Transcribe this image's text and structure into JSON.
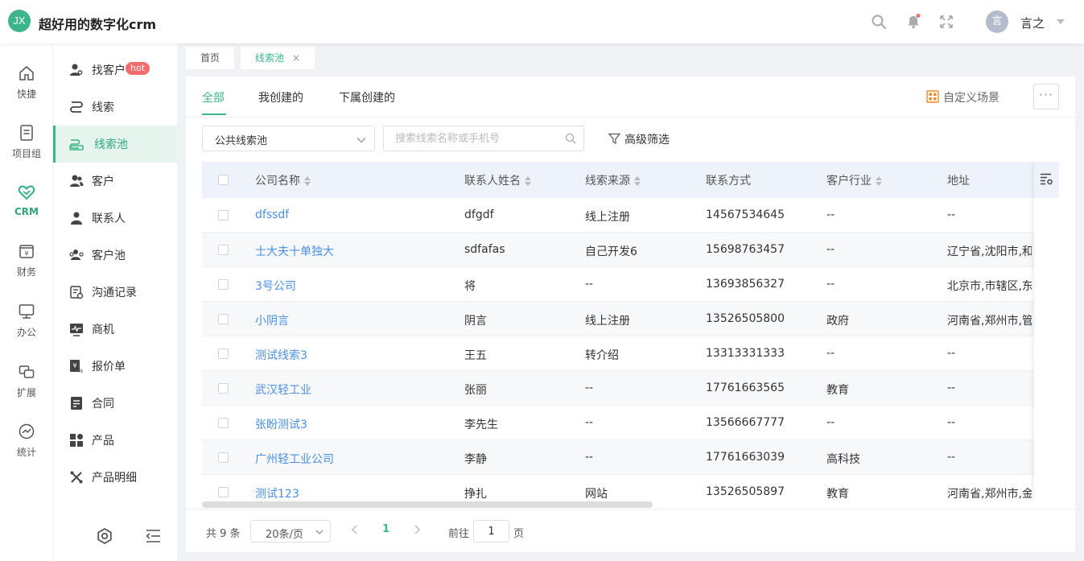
{
  "header": {
    "logo_text": "JX",
    "app_title": "超好用的数字化crm",
    "avatar_text": "言",
    "username": "言之",
    "notification_dot_color": "#f56c6c"
  },
  "rail": {
    "items": [
      {
        "label": "快捷",
        "icon": "home-icon"
      },
      {
        "label": "项目组",
        "icon": "document-icon"
      },
      {
        "label": "CRM",
        "icon": "handshake-heart-icon",
        "active": true
      },
      {
        "label": "财务",
        "icon": "finance-icon"
      },
      {
        "label": "办公",
        "icon": "monitor-icon"
      },
      {
        "label": "扩展",
        "icon": "extend-icon"
      },
      {
        "label": "统计",
        "icon": "stats-icon"
      }
    ]
  },
  "subnav": {
    "hot_badge": "hot",
    "items": [
      {
        "label": "找客户",
        "icon": "find-customer-icon"
      },
      {
        "label": "线索",
        "icon": "clue-icon"
      },
      {
        "label": "线索池",
        "icon": "clue-pool-icon",
        "active": true
      },
      {
        "label": "客户",
        "icon": "customer-icon"
      },
      {
        "label": "联系人",
        "icon": "contact-icon"
      },
      {
        "label": "客户池",
        "icon": "customer-pool-icon"
      },
      {
        "label": "沟通记录",
        "icon": "record-icon"
      },
      {
        "label": "商机",
        "icon": "opportunity-icon"
      },
      {
        "label": "报价单",
        "icon": "quote-icon"
      },
      {
        "label": "合同",
        "icon": "contract-icon"
      },
      {
        "label": "产品",
        "icon": "product-icon"
      },
      {
        "label": "产品明细",
        "icon": "product-detail-icon"
      }
    ]
  },
  "page_tabs": [
    {
      "label": "首页"
    },
    {
      "label": "线索池",
      "active": true,
      "close": "×"
    }
  ],
  "scene_tabs": [
    {
      "label": "全部",
      "active": true
    },
    {
      "label": "我创建的"
    },
    {
      "label": "下属创建的"
    }
  ],
  "custom_scene_label": "自定义场景",
  "more_label": "···",
  "filter": {
    "pool_value": "公共线索池",
    "search_placeholder": "搜索线索名称或手机号",
    "advanced_label": "高级筛选"
  },
  "table": {
    "columns": [
      "公司名称",
      "联系人姓名",
      "线索来源",
      "联系方式",
      "客户行业",
      "地址"
    ],
    "rows": [
      [
        "dfssdf",
        "dfgdf",
        "线上注册",
        "14567534645",
        "--",
        "--"
      ],
      [
        "士大夫十单独大",
        "sdfafas",
        "自己开发6",
        "15698763457",
        "--",
        "辽宁省,沈阳市,和..."
      ],
      [
        "3号公司",
        "将",
        "--",
        "13693856327",
        "--",
        "北京市,市辖区,东..."
      ],
      [
        "小阴言",
        "阴言",
        "线上注册",
        "13526505800",
        "政府",
        "河南省,郑州市,管..."
      ],
      [
        "测试线索3",
        "王五",
        "转介绍",
        "13313331333",
        "--",
        "--"
      ],
      [
        "武汉轻工业",
        "张丽",
        "--",
        "17761663565",
        "教育",
        "--"
      ],
      [
        "张盼测试3",
        "李先生",
        "--",
        "13566667777",
        "--",
        "--"
      ],
      [
        "广州轻工业公司",
        "李静",
        "--",
        "17761663039",
        "高科技",
        "--"
      ],
      [
        "测试123",
        "挣扎",
        "网站",
        "13526505897",
        "教育",
        "河南省,郑州市,金..."
      ]
    ]
  },
  "pagination": {
    "total": "共 9 条",
    "page_size": "20条/页",
    "current_page": "1",
    "goto_label": "前往",
    "goto_value": "1",
    "page_unit": "页"
  },
  "colors": {
    "accent": "#3cb58a",
    "link": "#4a90e2",
    "hot": "#f56c6c",
    "header_bg": "#eef3fb"
  }
}
